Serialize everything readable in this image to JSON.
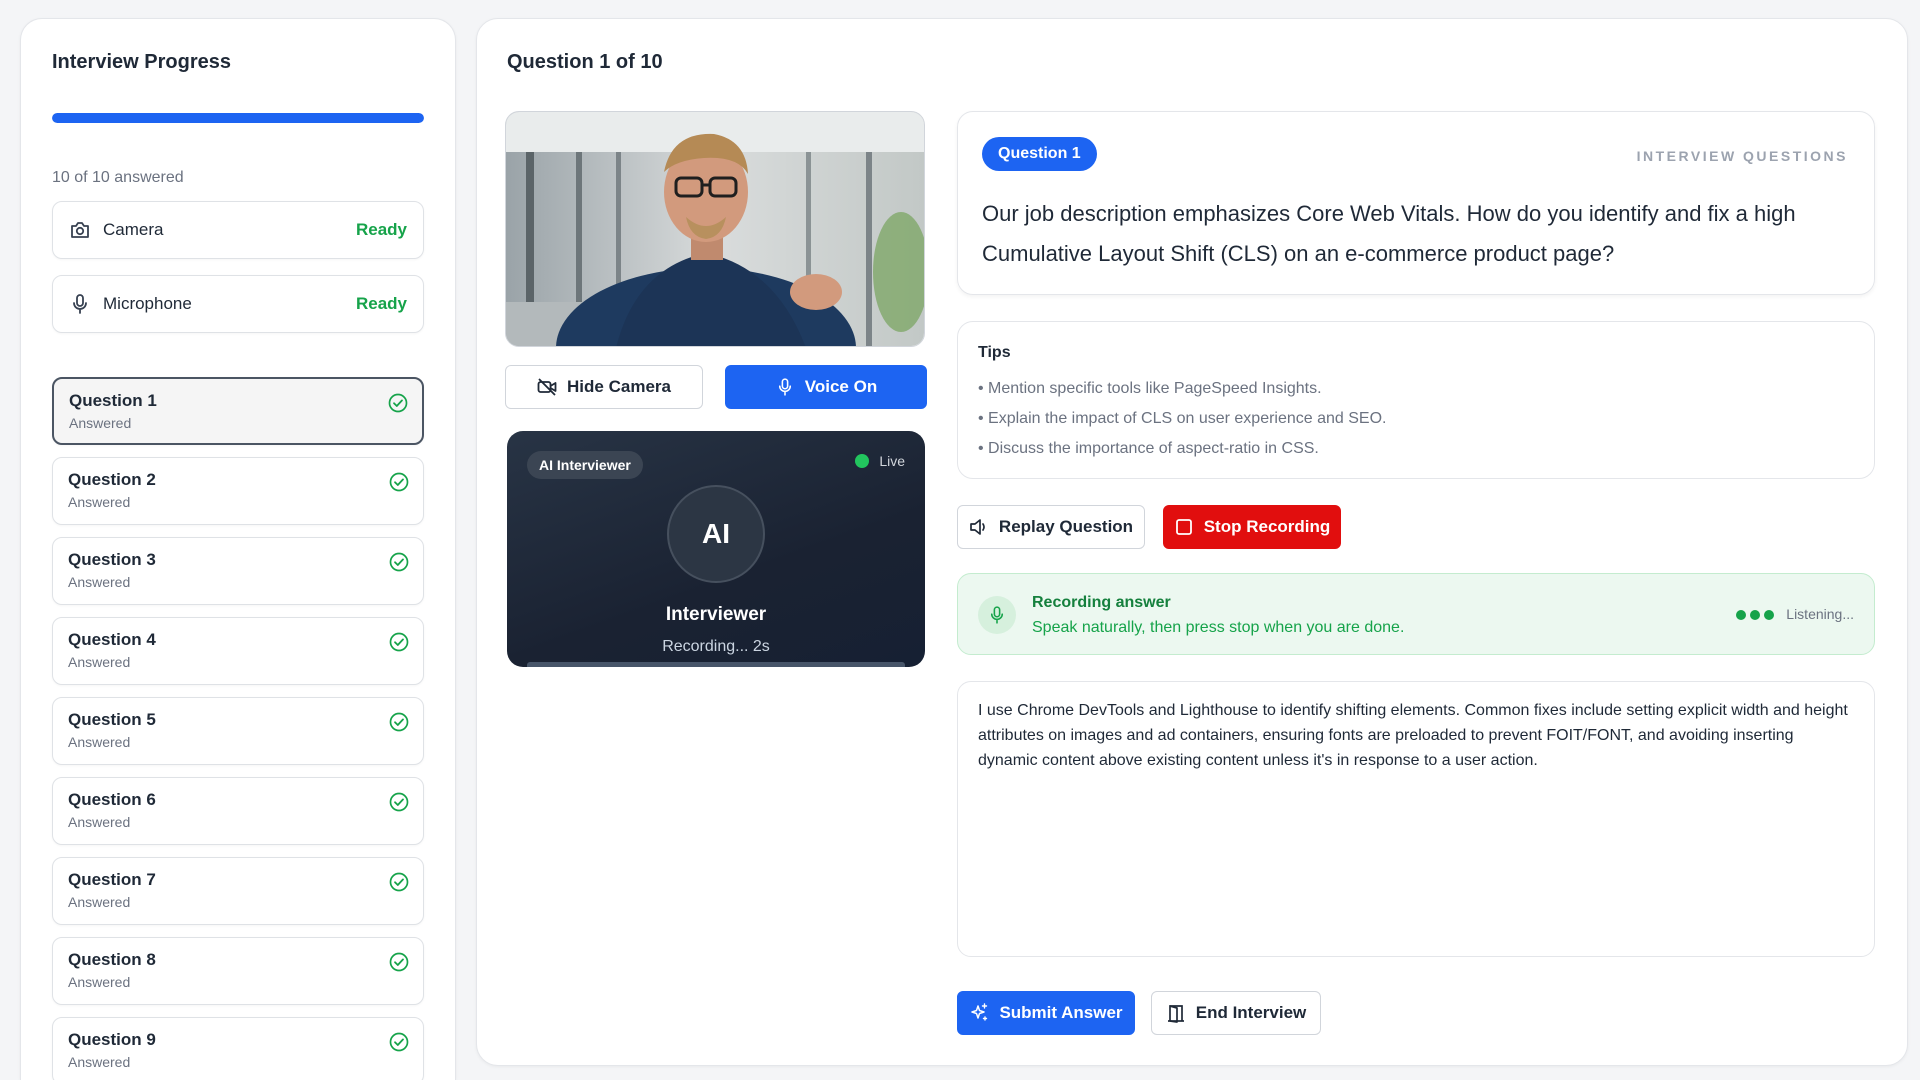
{
  "sidebar": {
    "title": "Interview Progress",
    "progress_percent": 100,
    "answered_text": "10 of 10 answered",
    "devices": [
      {
        "label": "Camera",
        "status": "Ready",
        "icon": "camera-icon"
      },
      {
        "label": "Microphone",
        "status": "Ready",
        "icon": "microphone-icon"
      }
    ],
    "questions": [
      {
        "label": "Question 1",
        "status": "Answered",
        "active": true
      },
      {
        "label": "Question 2",
        "status": "Answered"
      },
      {
        "label": "Question 3",
        "status": "Answered"
      },
      {
        "label": "Question 4",
        "status": "Answered"
      },
      {
        "label": "Question 5",
        "status": "Answered"
      },
      {
        "label": "Question 6",
        "status": "Answered"
      },
      {
        "label": "Question 7",
        "status": "Answered"
      },
      {
        "label": "Question 8",
        "status": "Answered"
      },
      {
        "label": "Question 9",
        "status": "Answered"
      }
    ]
  },
  "main": {
    "title": "Question 1 of 10",
    "camera_controls": {
      "hide_camera": "Hide Camera",
      "voice_on": "Voice On"
    },
    "ai_card": {
      "badge": "AI Interviewer",
      "live": "Live",
      "avatar": "AI",
      "name": "Interviewer",
      "status": "Recording... 2s"
    },
    "question_card": {
      "badge": "Question 1",
      "heading": "INTERVIEW QUESTIONS",
      "text": "Our job description emphasizes Core Web Vitals. How do you identify and fix a high Cumulative Layout Shift (CLS) on an e-commerce product page?"
    },
    "tips": {
      "title": "Tips",
      "items": [
        "• Mention specific tools like PageSpeed Insights.",
        "• Explain the impact of CLS on user experience and SEO.",
        "• Discuss the importance of aspect-ratio in CSS."
      ]
    },
    "actions": {
      "replay": "Replay Question",
      "stop": "Stop Recording"
    },
    "recording": {
      "title": "Recording answer",
      "subtitle": "Speak naturally, then press stop when you are done.",
      "status": "Listening..."
    },
    "answer_text": "I use Chrome DevTools and Lighthouse to identify shifting elements. Common fixes include setting explicit width and height attributes on images and ad containers, ensuring fonts are preloaded to prevent FOIT/FONT, and avoiding inserting dynamic content above existing content unless it's in response to a user action.",
    "footer": {
      "submit": "Submit Answer",
      "end": "End Interview"
    }
  },
  "colors": {
    "accent": "#1d64f2",
    "success": "#16a34a",
    "danger": "#e10e0e"
  }
}
